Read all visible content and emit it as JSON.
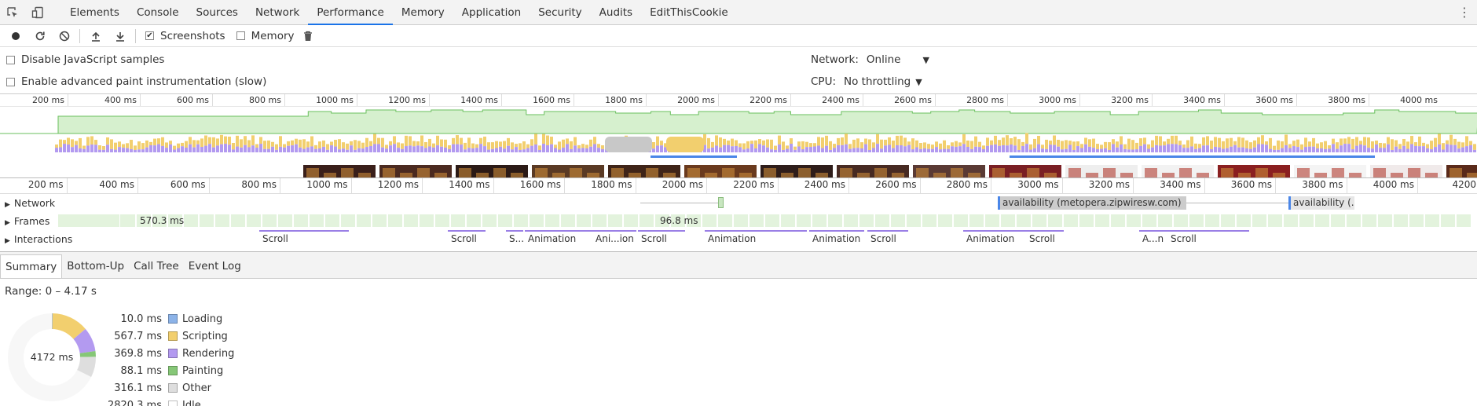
{
  "devtools": {
    "tabs": [
      {
        "label": "Elements",
        "active": false
      },
      {
        "label": "Console",
        "active": false
      },
      {
        "label": "Sources",
        "active": false
      },
      {
        "label": "Network",
        "active": false
      },
      {
        "label": "Performance",
        "active": true
      },
      {
        "label": "Memory",
        "active": false
      },
      {
        "label": "Application",
        "active": false
      },
      {
        "label": "Security",
        "active": false
      },
      {
        "label": "Audits",
        "active": false
      },
      {
        "label": "EditThisCookie",
        "active": false
      }
    ],
    "accent": "#1a73e8"
  },
  "toolbar": {
    "icons": [
      "record-icon",
      "reload-icon",
      "clear-icon",
      "upload-icon",
      "download-icon",
      "trash-icon"
    ],
    "screenshots_label": "Screenshots",
    "screenshots_checked": true,
    "memory_label": "Memory",
    "memory_checked": false
  },
  "settings": {
    "disable_js_samples": "Disable JavaScript samples",
    "advanced_paint": "Enable advanced paint instrumentation (slow)",
    "network_label": "Network:",
    "network_value": "Online",
    "cpu_label": "CPU:",
    "cpu_value": "No throttling"
  },
  "overview": {
    "ticks": [
      "200 ms",
      "400 ms",
      "600 ms",
      "800 ms",
      "1000 ms",
      "1200 ms",
      "1400 ms",
      "1600 ms",
      "1800 ms",
      "2000 ms",
      "2200 ms",
      "2400 ms",
      "2600 ms",
      "2800 ms",
      "3000 ms",
      "3200 ms",
      "3400 ms",
      "3600 ms",
      "3800 ms",
      "4000 ms"
    ]
  },
  "main": {
    "ticks": [
      "200 ms",
      "400 ms",
      "600 ms",
      "800 ms",
      "1000 ms",
      "1200 ms",
      "1400 ms",
      "1600 ms",
      "1800 ms",
      "2000 ms",
      "2200 ms",
      "2400 ms",
      "2600 ms",
      "2800 ms",
      "3000 ms",
      "3200 ms",
      "3400 ms",
      "3600 ms",
      "3800 ms",
      "4000 ms",
      "4200 n"
    ],
    "tracks": {
      "network": "Network",
      "frames": "Frames",
      "interactions": "Interactions"
    },
    "network_requests": [
      "availability (metopera.zipwiresw.com)",
      "availability (..."
    ],
    "frame_labels": [
      "570.3 ms",
      "96.8 ms"
    ],
    "interactions": [
      "Scroll",
      "Scroll",
      "S...l",
      "Animation",
      "Ani...ion",
      "Scroll",
      "Animation",
      "Animation",
      "Scroll",
      "Animation",
      "Scroll",
      "A...n",
      "Scroll"
    ]
  },
  "bottom": {
    "tabs": [
      {
        "label": "Summary",
        "active": true
      },
      {
        "label": "Bottom-Up",
        "active": false
      },
      {
        "label": "Call Tree",
        "active": false
      },
      {
        "label": "Event Log",
        "active": false
      }
    ],
    "range": "Range: 0 – 4.17 s",
    "total": "4172 ms",
    "categories": [
      {
        "value": "10.0 ms",
        "label": "Loading",
        "ms": 10.0,
        "color": "#8cb3e8"
      },
      {
        "value": "567.7 ms",
        "label": "Scripting",
        "ms": 567.7,
        "color": "#f2cf6e"
      },
      {
        "value": "369.8 ms",
        "label": "Rendering",
        "ms": 369.8,
        "color": "#b39af0"
      },
      {
        "value": "88.1 ms",
        "label": "Painting",
        "ms": 88.1,
        "color": "#86c777"
      },
      {
        "value": "316.1 ms",
        "label": "Other",
        "ms": 316.1,
        "color": "#dedede"
      },
      {
        "value": "2820.3 ms",
        "label": "Idle",
        "ms": 2820.3,
        "color": "#ffffff"
      }
    ]
  }
}
